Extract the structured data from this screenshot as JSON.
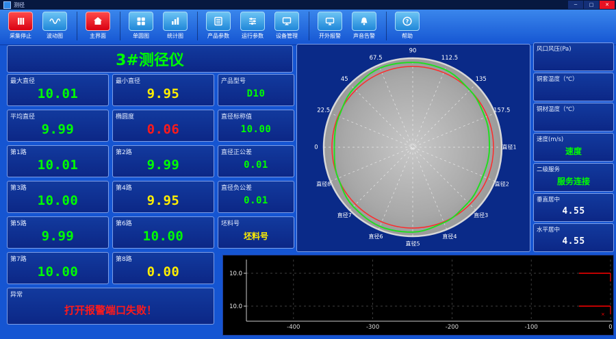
{
  "window": {
    "title": "测径",
    "minimize_label": "─",
    "maximize_label": "□",
    "close_label": "✕"
  },
  "colors": {
    "background_blue": "#1555d2",
    "panel_blue": "#0c2786",
    "value_green": "#00ff00",
    "value_yellow": "#ffee00",
    "alarm_red": "#ff1a1a",
    "active_button_red": "#e8001e"
  },
  "toolbar": {
    "buttons": [
      {
        "id": "stop-capture",
        "label": "采集停止",
        "icon": "stop-icon",
        "variant": "red",
        "sep_after": false
      },
      {
        "id": "wave-chart",
        "label": "波动图",
        "icon": "wave-icon",
        "variant": "blue",
        "sep_after": true
      },
      {
        "id": "main-screen",
        "label": "主界面",
        "icon": "home-icon",
        "variant": "red",
        "sep_after": true
      },
      {
        "id": "single-circle-chart",
        "label": "单圆图",
        "icon": "circle-grid-icon",
        "variant": "blue",
        "sep_after": false
      },
      {
        "id": "statistics-chart",
        "label": "统计图",
        "icon": "bar-chart-icon",
        "variant": "blue",
        "sep_after": true
      },
      {
        "id": "product-params",
        "label": "产品参数",
        "icon": "product-icon",
        "variant": "blue",
        "sep_after": false
      },
      {
        "id": "run-params",
        "label": "运行参数",
        "icon": "run-icon",
        "variant": "blue",
        "sep_after": false
      },
      {
        "id": "device-manage",
        "label": "设备管理",
        "icon": "device-icon",
        "variant": "blue",
        "sep_after": true
      },
      {
        "id": "external-alarm",
        "label": "开外报警",
        "icon": "monitor-icon",
        "variant": "blue",
        "sep_after": false
      },
      {
        "id": "sound-alarm",
        "label": "声音告警",
        "icon": "bell-icon",
        "variant": "blue",
        "sep_after": true
      },
      {
        "id": "help",
        "label": "帮助",
        "icon": "help-icon",
        "variant": "blue",
        "sep_after": false
      }
    ]
  },
  "gauge": {
    "title": "3#测径仪"
  },
  "metrics": [
    {
      "id": "max-diameter",
      "label": "最大直径",
      "value": "10.01",
      "color": "green",
      "row": 1,
      "col": 1
    },
    {
      "id": "min-diameter",
      "label": "最小直径",
      "value": "9.95",
      "color": "yellow",
      "row": 1,
      "col": 2
    },
    {
      "id": "product-model",
      "label": "产品型号",
      "value": "D10",
      "color": "green",
      "row": 1,
      "col": 3
    },
    {
      "id": "avg-diameter",
      "label": "平均直径",
      "value": "9.99",
      "color": "green",
      "row": 2,
      "col": 1
    },
    {
      "id": "ovality",
      "label": "椭圆度",
      "value": "0.06",
      "color": "red",
      "row": 2,
      "col": 2
    },
    {
      "id": "nominal-diameter",
      "label": "直径标称值",
      "value": "10.00",
      "color": "green",
      "row": 2,
      "col": 3
    },
    {
      "id": "path-1",
      "label": "第1路",
      "value": "10.01",
      "color": "green",
      "row": 3,
      "col": 1
    },
    {
      "id": "path-2",
      "label": "第2路",
      "value": "9.99",
      "color": "green",
      "row": 3,
      "col": 2
    },
    {
      "id": "plus-tolerance",
      "label": "直径正公差",
      "value": "0.01",
      "color": "green",
      "row": 3,
      "col": 3
    },
    {
      "id": "path-3",
      "label": "第3路",
      "value": "10.00",
      "color": "green",
      "row": 4,
      "col": 1
    },
    {
      "id": "path-4",
      "label": "第4路",
      "value": "9.95",
      "color": "yellow",
      "row": 4,
      "col": 2
    },
    {
      "id": "minus-tolerance",
      "label": "直径负公差",
      "value": "0.01",
      "color": "green",
      "row": 4,
      "col": 3
    },
    {
      "id": "path-5",
      "label": "第5路",
      "value": "9.99",
      "color": "green",
      "row": 5,
      "col": 1
    },
    {
      "id": "path-6",
      "label": "第6路",
      "value": "10.00",
      "color": "green",
      "row": 5,
      "col": 2
    },
    {
      "id": "billet-no",
      "label": "坯料号",
      "value": "坯料号",
      "color": "yellow",
      "row": 5,
      "col": 3
    },
    {
      "id": "path-7",
      "label": "第7路",
      "value": "10.00",
      "color": "green",
      "row": 6,
      "col": 1
    },
    {
      "id": "path-8",
      "label": "第8路",
      "value": "0.00",
      "color": "yellow",
      "row": 6,
      "col": 2
    },
    {
      "id": "alarm",
      "label": "异常",
      "value": "打开报警端口失败！",
      "color": "red",
      "row": 7,
      "col": 1,
      "colspan": 2
    }
  ],
  "right_panel": [
    {
      "id": "air-pressure",
      "label": "风口风压(Pa)",
      "value": "",
      "color": "green"
    },
    {
      "id": "sleeve-temperature",
      "label": "铜套温度（℃）",
      "value": "",
      "color": "green"
    },
    {
      "id": "material-temperature",
      "label": "铜材温度（℃）",
      "value": "",
      "color": "green"
    },
    {
      "id": "speed",
      "label": "速度(m/s)",
      "value": "速度",
      "color": "green"
    },
    {
      "id": "secondary-service",
      "label": "二级服务",
      "value": "服务连接",
      "color": "green"
    },
    {
      "id": "vertical-center",
      "label": "垂直居中",
      "value": "4.55",
      "color": "white"
    },
    {
      "id": "horizontal-center",
      "label": "水平居中",
      "value": "4.55",
      "color": "white"
    }
  ],
  "chart_data": [
    {
      "type": "polar",
      "angle_tick_labels": [
        "0",
        "22.5",
        "45",
        "67.5",
        "90",
        "112.5",
        "135",
        "157.5"
      ],
      "diameter_labels": [
        "直径1",
        "直径2",
        "直径3",
        "直径4",
        "直径5",
        "直径6",
        "直径7",
        "直径8"
      ],
      "nominal_value": 10.0,
      "profile_radii": [
        0.95,
        0.97,
        1.0,
        1.04,
        1.05,
        1.06,
        1.03,
        0.99,
        0.97,
        1.0,
        1.04,
        1.06,
        1.05,
        1.01,
        0.97,
        0.94
      ],
      "ring_color": "#ff2a2a",
      "profile_color": "#22dd22",
      "disc_color": "#a9a9a9"
    },
    {
      "type": "line",
      "x_tick_labels": [
        "-400",
        "-300",
        "-200",
        "-100",
        "0"
      ],
      "subplots": [
        {
          "y_tick_label": "10.0",
          "value": 10.0
        },
        {
          "y_tick_label": "10.0",
          "value": 10.0,
          "marker": "×"
        }
      ],
      "series_color": "#ff0000",
      "background": "#000000",
      "grid": true
    }
  ]
}
